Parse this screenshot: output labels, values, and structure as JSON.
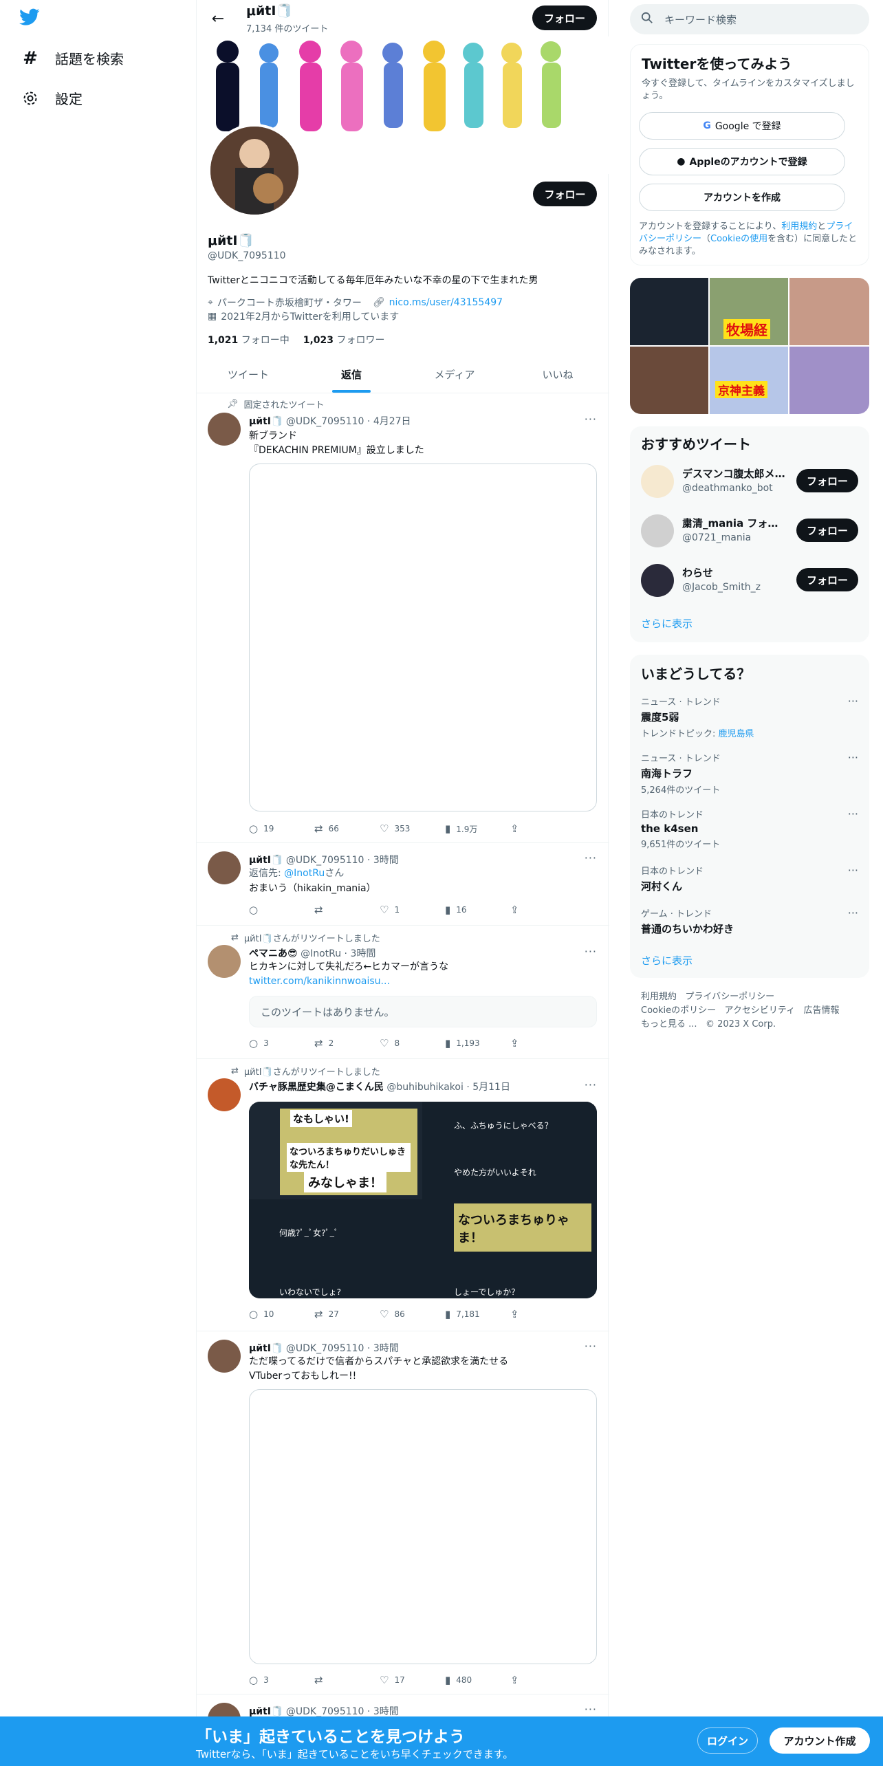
{
  "left_nav": {
    "items": [
      {
        "icon": "hashtag-icon",
        "label": "話題を検索"
      },
      {
        "icon": "gear-icon",
        "label": "設定"
      }
    ]
  },
  "header": {
    "name": "μйtI🧻",
    "tweet_count": "7,134 件のツイート",
    "follow_label": "フォロー"
  },
  "profile": {
    "name": "μйtI🧻",
    "handle": "@UDK_7095110",
    "bio": "Twitterとニコニコで活動してる毎年厄年みたいな不幸の星の下で生まれた男",
    "location": "パークコート赤坂檜町ザ・タワー",
    "url": "nico.ms/user/43155497",
    "joined": "2021年2月からTwitterを利用しています",
    "following_count": "1,021",
    "following_label": "フォロー中",
    "followers_count": "1,023",
    "followers_label": "フォロワー",
    "follow_label": "フォロー"
  },
  "tabs": [
    "ツイート",
    "返信",
    "メディア",
    "いいね"
  ],
  "tweets": [
    {
      "pinned_label": "固定されたツイート",
      "name": "μйtI🧻",
      "handle": "@UDK_7095110",
      "time": "4月27日",
      "text1": "新ブランド",
      "text2": "『DEKACHIN PREMIUM』設立しました",
      "replies": "19",
      "retweets": "66",
      "likes": "353",
      "views": "1.9万"
    },
    {
      "name": "μйtI🧻",
      "handle": "@UDK_7095110",
      "time": "3時間",
      "reply_prefix": "返信先: ",
      "reply_to": "@InotRu",
      "reply_suffix": "さん",
      "text": "おまいう（hikakin_mania）",
      "replies": "",
      "retweets": "",
      "likes": "1",
      "views": "16"
    },
    {
      "rt_label": "μйtI🧻さんがリツイートしました",
      "name": "ペマニあ😎",
      "handle": "@InotRu",
      "time": "3時間",
      "text": "ヒカキンに対して失礼だろ←ヒカマーが言うな",
      "link": "twitter.com/kanikinnwoaisu...",
      "quote": "このツイートはありません。",
      "replies": "3",
      "retweets": "2",
      "likes": "8",
      "views": "1,193"
    },
    {
      "rt_label": "μйtI🧻さんがリツイートしました",
      "name": "バチャ豚黒歴史集@こまくん民",
      "handle": "@buhibuhikakoi",
      "time": "5月11日",
      "replies": "10",
      "retweets": "27",
      "likes": "86",
      "views": "7,181",
      "media_texts": [
        "なもしゃい!",
        "なついろまちゅりだいしゅきな先たん！",
        "みなしゃま！",
        "ふ、ふちゅうにしゃべる？",
        "やめた方がいいよそれ",
        "何歳?ﾟ_ﾟ女?ﾟ_ﾟ",
        "いわないでしょ?",
        "なついろまちゅりゃま！",
        "しょーでしゅか？"
      ]
    },
    {
      "name": "μйtI🧻",
      "handle": "@UDK_7095110",
      "time": "3時間",
      "text1": "ただ喋ってるだけで信者からスパチャと承認欲求を満たせる",
      "text2": "VTuberっておもしれー!!",
      "replies": "3",
      "retweets": "",
      "likes": "17",
      "views": "480"
    },
    {
      "name": "μйtI🧻",
      "handle": "@UDK_7095110",
      "time": "3時間"
    }
  ],
  "sidebar": {
    "search_placeholder": "キーワード検索",
    "signup": {
      "title": "Twitterを使ってみよう",
      "subtitle": "今すぐ登録して、タイムラインをカスタマイズしましょう。",
      "google": "Google で登録",
      "apple": "Appleのアカウントで登録",
      "create": "アカウントを作成",
      "terms_pre": "アカウントを登録することにより、",
      "terms": "利用規約",
      "terms_mid": "と",
      "privacy": "プライバシーポリシー",
      "cookie_pre": "（",
      "cookie": "Cookieの使用",
      "terms_post": "を含む）に同意したとみなされます。"
    },
    "recommended": {
      "title": "おすすめツイート",
      "items": [
        {
          "name": "デスマンコ腹太郎メ...",
          "handle": "@deathmanko_bot"
        },
        {
          "name": "粛清_mania フォロ...",
          "handle": "@0721_mania"
        },
        {
          "name": "わらせ",
          "handle": "@Jacob_Smith_z"
        }
      ],
      "follow_label": "フォロー",
      "more": "さらに表示"
    },
    "trends": {
      "title": "いまどうしてる？",
      "items": [
        {
          "context": "ニュース · トレンド",
          "name": "震度5弱",
          "sub_pre": "トレンドトピック: ",
          "sub_link": "鹿児島県"
        },
        {
          "context": "ニュース · トレンド",
          "name": "南海トラフ",
          "sub": "5,264件のツイート"
        },
        {
          "context": "日本のトレンド",
          "name": "the k4sen",
          "sub": "9,651件のツイート"
        },
        {
          "context": "日本のトレンド",
          "name": "河村くん"
        },
        {
          "context": "ゲーム · トレンド",
          "name": "普通のちいかわ好き"
        }
      ],
      "more": "さらに表示"
    },
    "footer": [
      "利用規約",
      "プライバシーポリシー",
      "Cookieのポリシー",
      "アクセシビリティ",
      "広告情報",
      "もっと見る ...",
      "© 2023 X Corp."
    ],
    "thumb_texts": [
      "牧場経",
      "京神主義"
    ]
  },
  "bottom": {
    "title": "「いま」起きていることを見つけよう",
    "subtitle": "Twitterなら、「いま」起きていることをいち早くチェックできます。",
    "login": "ログイン",
    "signup": "アカウント作成"
  },
  "colors": {
    "accent": "#1d9bf0",
    "dark": "#0f1419",
    "muted": "#536471",
    "bg_light": "#f7f9f9"
  }
}
